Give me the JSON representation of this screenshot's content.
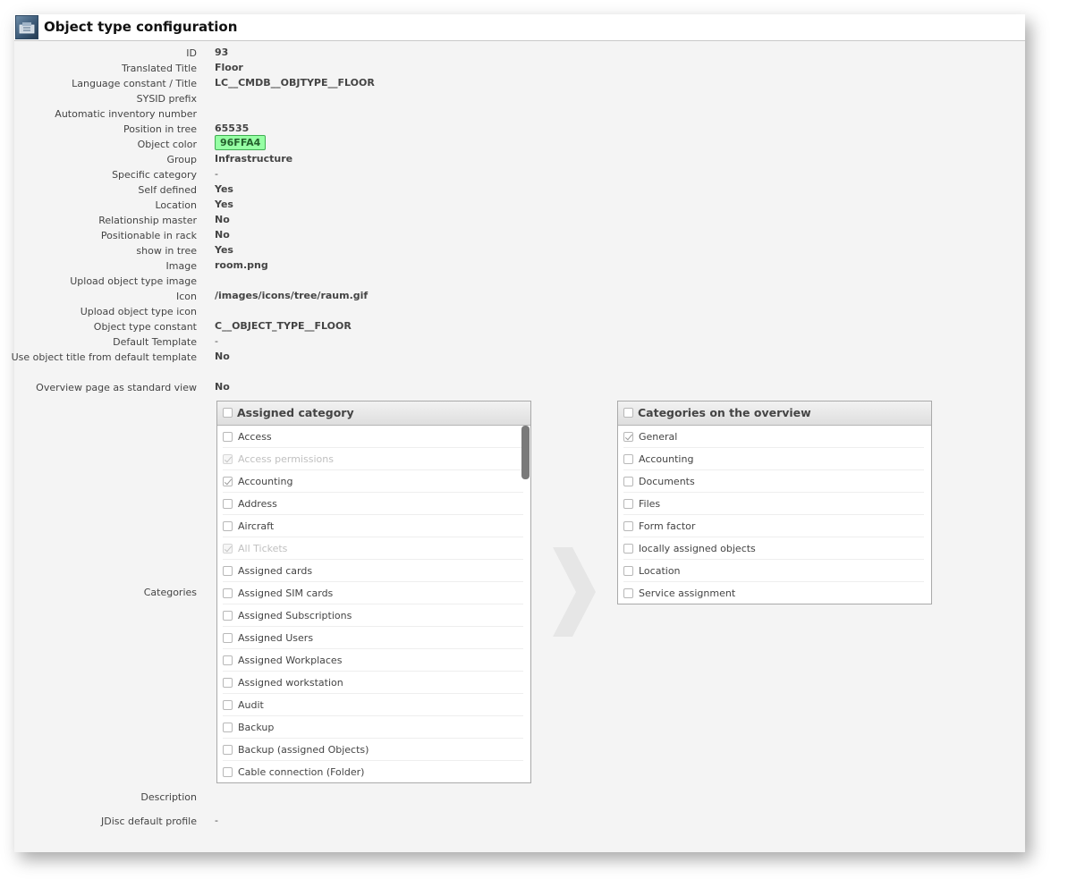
{
  "header": {
    "title": "Object type configuration"
  },
  "fields": [
    {
      "label": "ID",
      "value": "93"
    },
    {
      "label": "Translated Title",
      "value": "Floor"
    },
    {
      "label": "Language constant / Title",
      "value": "LC__CMDB__OBJTYPE__FLOOR"
    },
    {
      "label": "SYSID prefix",
      "value": ""
    },
    {
      "label": "Automatic inventory number",
      "value": ""
    },
    {
      "label": "Position in tree",
      "value": "65535"
    },
    {
      "label": "Object color",
      "value": "96FFA4"
    },
    {
      "label": "Group",
      "value": "Infrastructure"
    },
    {
      "label": "Specific category",
      "value": "-"
    },
    {
      "label": "Self defined",
      "value": "Yes"
    },
    {
      "label": "Location",
      "value": "Yes"
    },
    {
      "label": "Relationship master",
      "value": "No"
    },
    {
      "label": "Positionable in rack",
      "value": "No"
    },
    {
      "label": "show in tree",
      "value": "Yes"
    },
    {
      "label": "Image",
      "value": "room.png"
    },
    {
      "label": "Upload object type image",
      "value": ""
    },
    {
      "label": "Icon",
      "value": "/images/icons/tree/raum.gif"
    },
    {
      "label": "Upload object type icon",
      "value": ""
    },
    {
      "label": "Object type constant",
      "value": "C__OBJECT_TYPE__FLOOR"
    },
    {
      "label": "Default Template",
      "value": "-"
    },
    {
      "label": "Use object title from default template",
      "value": "No"
    },
    {
      "label": "Overview page as standard view",
      "value": "No"
    }
  ],
  "colors": {
    "object_color": "#96FFA4"
  },
  "categories_label": "Categories",
  "assigned": {
    "title": "Assigned category",
    "items": [
      {
        "label": "Access",
        "checked": false,
        "disabled": false
      },
      {
        "label": "Access permissions",
        "checked": true,
        "disabled": true
      },
      {
        "label": "Accounting",
        "checked": true,
        "disabled": false
      },
      {
        "label": "Address",
        "checked": false,
        "disabled": false
      },
      {
        "label": "Aircraft",
        "checked": false,
        "disabled": false
      },
      {
        "label": "All Tickets",
        "checked": true,
        "disabled": true
      },
      {
        "label": "Assigned cards",
        "checked": false,
        "disabled": false
      },
      {
        "label": "Assigned SIM cards",
        "checked": false,
        "disabled": false
      },
      {
        "label": "Assigned Subscriptions",
        "checked": false,
        "disabled": false
      },
      {
        "label": "Assigned Users",
        "checked": false,
        "disabled": false
      },
      {
        "label": "Assigned Workplaces",
        "checked": false,
        "disabled": false
      },
      {
        "label": "Assigned workstation",
        "checked": false,
        "disabled": false
      },
      {
        "label": "Audit",
        "checked": false,
        "disabled": false
      },
      {
        "label": "Backup",
        "checked": false,
        "disabled": false
      },
      {
        "label": "Backup (assigned Objects)",
        "checked": false,
        "disabled": false
      },
      {
        "label": "Cable connection (Folder)",
        "checked": false,
        "disabled": false
      }
    ]
  },
  "overview": {
    "title": "Categories on the overview",
    "items": [
      {
        "label": "General",
        "checked": true,
        "disabled": false
      },
      {
        "label": "Accounting",
        "checked": false,
        "disabled": false
      },
      {
        "label": "Documents",
        "checked": false,
        "disabled": false
      },
      {
        "label": "Files",
        "checked": false,
        "disabled": false
      },
      {
        "label": "Form factor",
        "checked": false,
        "disabled": false
      },
      {
        "label": "locally assigned objects",
        "checked": false,
        "disabled": false
      },
      {
        "label": "Location",
        "checked": false,
        "disabled": false
      },
      {
        "label": "Service assignment",
        "checked": false,
        "disabled": false
      }
    ]
  },
  "description_label": "Description",
  "jdisc": {
    "label": "JDisc default profile",
    "value": "-"
  }
}
